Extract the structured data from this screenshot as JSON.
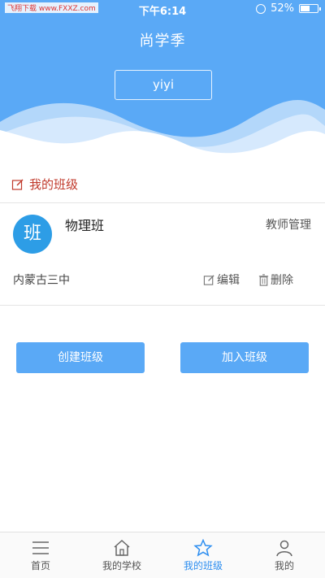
{
  "status_bar": {
    "left_text": "飞翔下载 www.FXXZ.com",
    "time": "下午6:14",
    "battery": "52%"
  },
  "header": {
    "title": "尚学季",
    "username": "yiyi"
  },
  "section": {
    "title": "我的班级"
  },
  "class_card": {
    "avatar_char": "班",
    "name": "物理班",
    "manage_label": "教师管理",
    "school": "内蒙古三中",
    "edit_label": "编辑",
    "delete_label": "删除"
  },
  "actions": {
    "create_label": "创建班级",
    "join_label": "加入班级"
  },
  "tabbar": {
    "items": [
      {
        "label": "首页"
      },
      {
        "label": "我的学校"
      },
      {
        "label": "我的班级",
        "active": true
      },
      {
        "label": "我的"
      }
    ]
  },
  "colors": {
    "primary": "#5aa9f6",
    "accent_red": "#c0392b",
    "avatar": "#2d9de6",
    "active_tab": "#2d8ef0"
  }
}
